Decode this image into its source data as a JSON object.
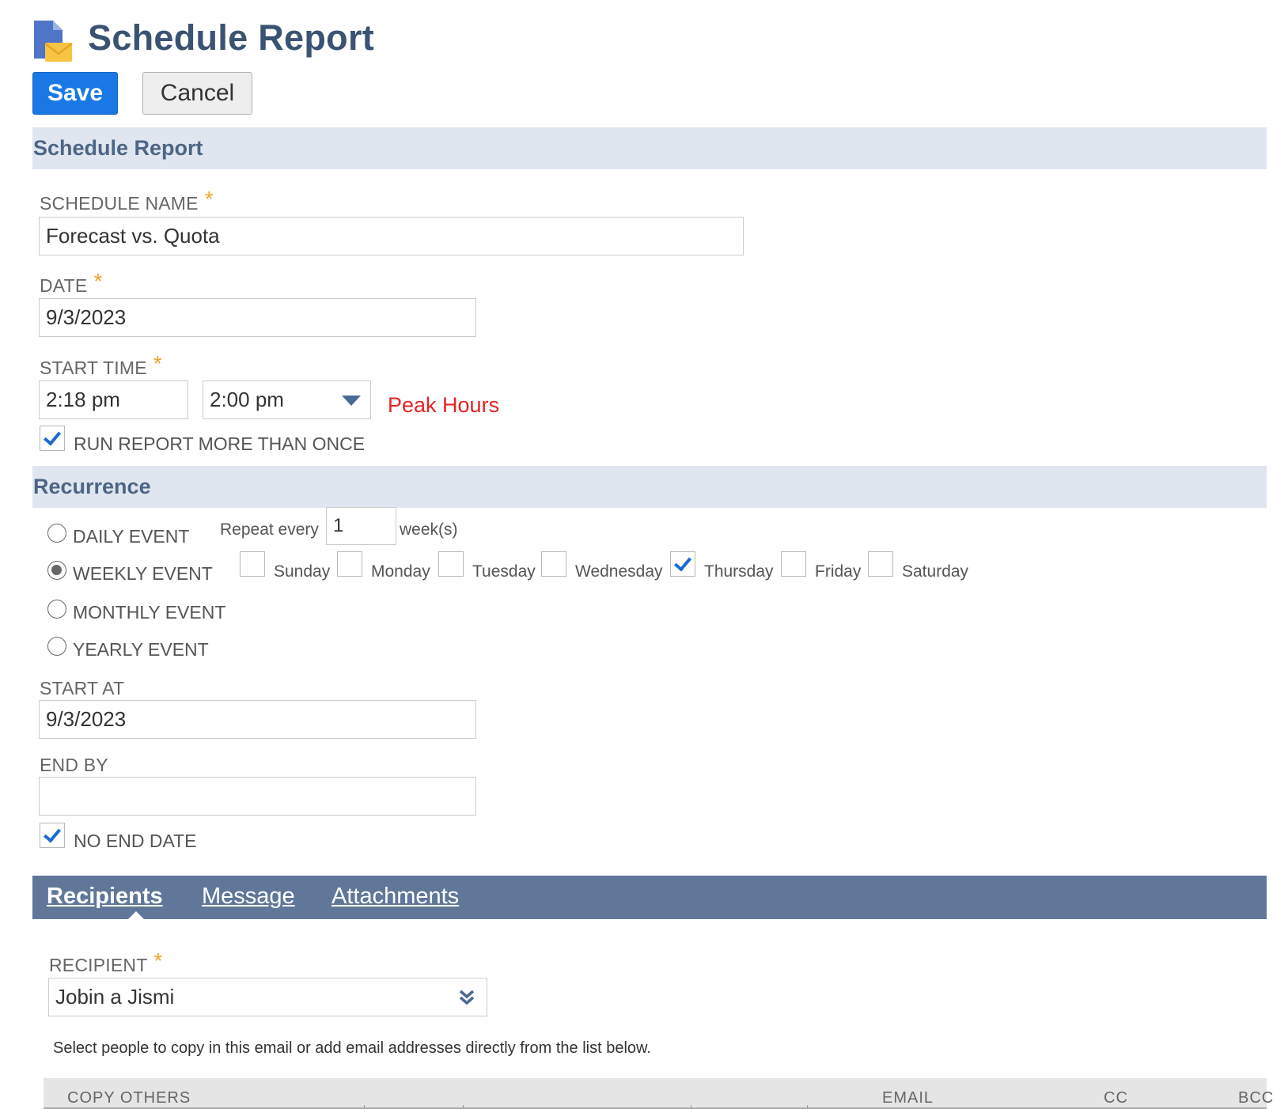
{
  "header": {
    "title": "Schedule Report",
    "save_label": "Save",
    "cancel_label": "Cancel"
  },
  "section_schedule": {
    "title": "Schedule Report"
  },
  "schedule_name": {
    "label": "SCHEDULE NAME",
    "required": "*",
    "value": "Forecast vs. Quota"
  },
  "date": {
    "label": "DATE",
    "required": "*",
    "value": "9/3/2023"
  },
  "start_time": {
    "label": "START TIME",
    "required": "*",
    "time_value": "2:18 pm",
    "select_value": "2:00 pm",
    "note": "Peak Hours"
  },
  "run_more_than_once": {
    "label": "RUN REPORT MORE THAN ONCE",
    "checked": true
  },
  "section_recurrence": {
    "title": "Recurrence"
  },
  "recurrence": {
    "options": [
      {
        "label": "DAILY EVENT",
        "selected": false
      },
      {
        "label": "WEEKLY EVENT",
        "selected": true
      },
      {
        "label": "MONTHLY EVENT",
        "selected": false
      },
      {
        "label": "YEARLY EVENT",
        "selected": false
      }
    ],
    "repeat_every_label": "Repeat every",
    "repeat_every_value": "1",
    "repeat_unit": "week(s)",
    "days": [
      {
        "label": "Sunday",
        "checked": false
      },
      {
        "label": "Monday",
        "checked": false
      },
      {
        "label": "Tuesday",
        "checked": false
      },
      {
        "label": "Wednesday",
        "checked": false
      },
      {
        "label": "Thursday",
        "checked": true
      },
      {
        "label": "Friday",
        "checked": false
      },
      {
        "label": "Saturday",
        "checked": false
      }
    ]
  },
  "start_at": {
    "label": "START AT",
    "value": "9/3/2023"
  },
  "end_by": {
    "label": "END BY",
    "value": ""
  },
  "no_end_date": {
    "label": "NO END DATE",
    "checked": true
  },
  "tabs": [
    {
      "label": "Recipients",
      "active": true
    },
    {
      "label": "Message",
      "active": false
    },
    {
      "label": "Attachments",
      "active": false
    }
  ],
  "recipient": {
    "label": "RECIPIENT",
    "required": "*",
    "value": "Jobin a Jismi"
  },
  "help_text": "Select people to copy in this email or add email addresses directly from the list below.",
  "copy_grid": {
    "columns": [
      "COPY OTHERS",
      "EMAIL",
      "CC",
      "BCC"
    ]
  },
  "colors": {
    "primary_button": "#1978e5",
    "section_bar": "#e0e6ef",
    "tab_bar": "#607799",
    "required_star": "#f3a229",
    "warning_text": "#e52222"
  }
}
